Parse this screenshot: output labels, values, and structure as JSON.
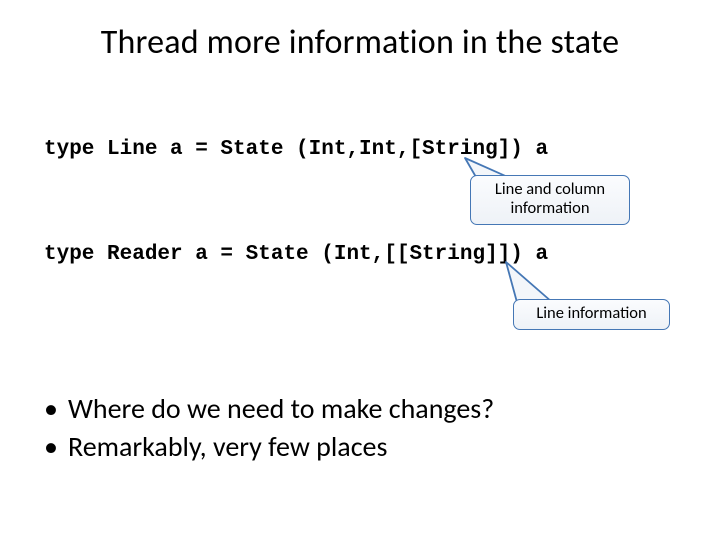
{
  "title": "Thread more information in the state",
  "code_line_1": "type Line a = State (Int,Int,[String]) a",
  "code_line_2": "type Reader a = State (Int,[[String]]) a",
  "callout_1_line1": "Line and column",
  "callout_1_line2": "information",
  "callout_2": "Line  information",
  "bullet_1": "Where do we need to make changes?",
  "bullet_2": "Remarkably, very few places"
}
